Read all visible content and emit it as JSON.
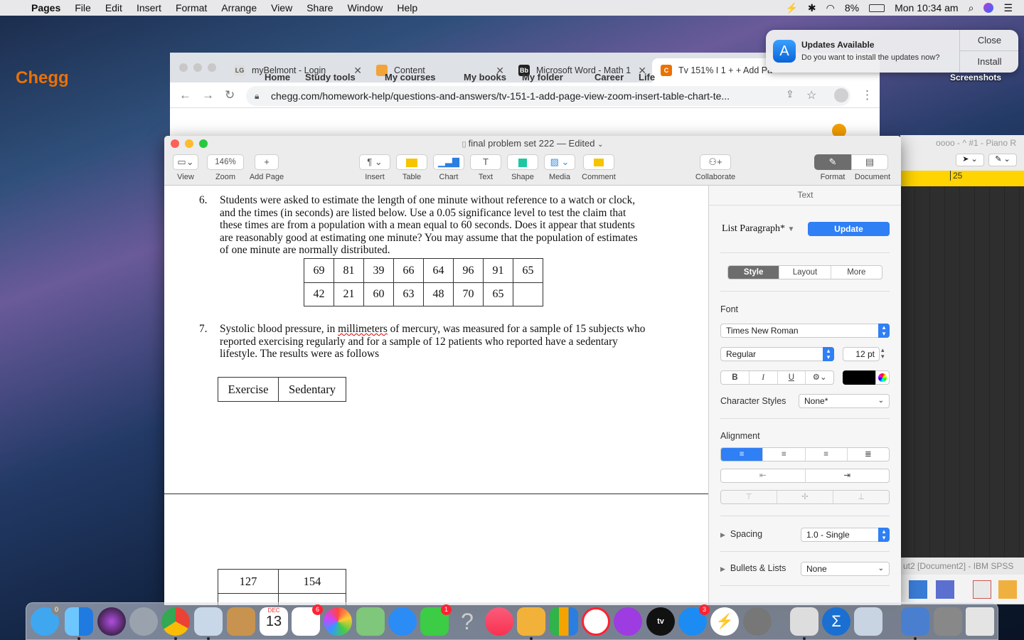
{
  "menubar": {
    "app_name": "Pages",
    "items": [
      "File",
      "Edit",
      "Insert",
      "Format",
      "Arrange",
      "View",
      "Share",
      "Window",
      "Help"
    ],
    "battery": "8%",
    "clock": "Mon 10:34 am"
  },
  "notification": {
    "title": "Updates Available",
    "body": "Do you want to install the updates now?",
    "close_label": "Close",
    "install_label": "Install"
  },
  "desktop": {
    "folder_label": "Screenshots"
  },
  "chrome": {
    "tabs": [
      {
        "title": "myBelmont - Login",
        "favicon": "LG"
      },
      {
        "title": "Content",
        "favicon": ""
      },
      {
        "title": "Microsoft Word - Math 1",
        "favicon": "Bb"
      },
      {
        "title": "Tv 151% I 1 + + Add Pa",
        "favicon": "C"
      }
    ],
    "url": "chegg.com/homework-help/questions-and-answers/tv-151-1-add-page-view-zoom-insert-table-chart-te..."
  },
  "chegg": {
    "logo": "Chegg",
    "nav": [
      "Home",
      "Study tools",
      "My courses",
      "My books",
      "My folder",
      "Career",
      "Life"
    ]
  },
  "bg_window": {
    "title": "oooo - ^ #1 - Piano R",
    "timeline_marker": "25",
    "spss_title": "ut2 [Document2] - IBM SPSS"
  },
  "pages": {
    "doc_title": "final problem set 222 — Edited",
    "toolbar": {
      "view": "View",
      "zoom_value": "146%",
      "zoom": "Zoom",
      "add_page": "Add Page",
      "insert": "Insert",
      "table": "Table",
      "chart": "Chart",
      "text": "Text",
      "shape": "Shape",
      "media": "Media",
      "comment": "Comment",
      "collaborate": "Collaborate",
      "format": "Format",
      "document": "Document"
    },
    "q6": {
      "number": "6.",
      "lines": [
        "Students were asked to estimate the length of one minute without reference to a watch or clock,",
        "and the times (in seconds) are listed below. Use a 0.05 significance level to test the claim that",
        "these times are from a population with a mean equal to 60 seconds. Does it appear that students",
        "are reasonably good at estimating one minute? You may assume that the population of estimates",
        "of one minute are normally distributed."
      ],
      "table": [
        [
          "69",
          "81",
          "39",
          "66",
          "64",
          "96",
          "91",
          "65"
        ],
        [
          "42",
          "21",
          "60",
          "63",
          "48",
          "70",
          "65",
          ""
        ]
      ]
    },
    "q7": {
      "number": "7.",
      "line1_pre": "Systolic blood pressure, in ",
      "line1_err": "millimeters",
      "line1_post": " of mercury, was measured for a sample of 15 subjects who",
      "line2": "reported exercising regularly and for a sample of 12 patients who reported have a sedentary",
      "line3": "lifestyle. The results were as follows",
      "headers": [
        "Exercise",
        "Sedentary"
      ],
      "row1": [
        "127",
        "154"
      ]
    },
    "inspector": {
      "header": "Text",
      "paragraph_style": "List Paragraph*",
      "update": "Update",
      "tabs": [
        "Style",
        "Layout",
        "More"
      ],
      "font_label": "Font",
      "font_family": "Times New Roman",
      "font_style": "Regular",
      "font_size": "12 pt",
      "bold": "B",
      "italic": "I",
      "underline": "U",
      "character_styles_label": "Character Styles",
      "character_styles_value": "None*",
      "alignment_label": "Alignment",
      "spacing_label": "Spacing",
      "spacing_value": "1.0 - Single",
      "bullets_label": "Bullets & Lists",
      "bullets_value": "None"
    }
  },
  "dock": {
    "badges": {
      "messages": "6",
      "facetime": "1",
      "appstore": "3"
    },
    "calendar_month": "DEC",
    "calendar_day": "13"
  }
}
